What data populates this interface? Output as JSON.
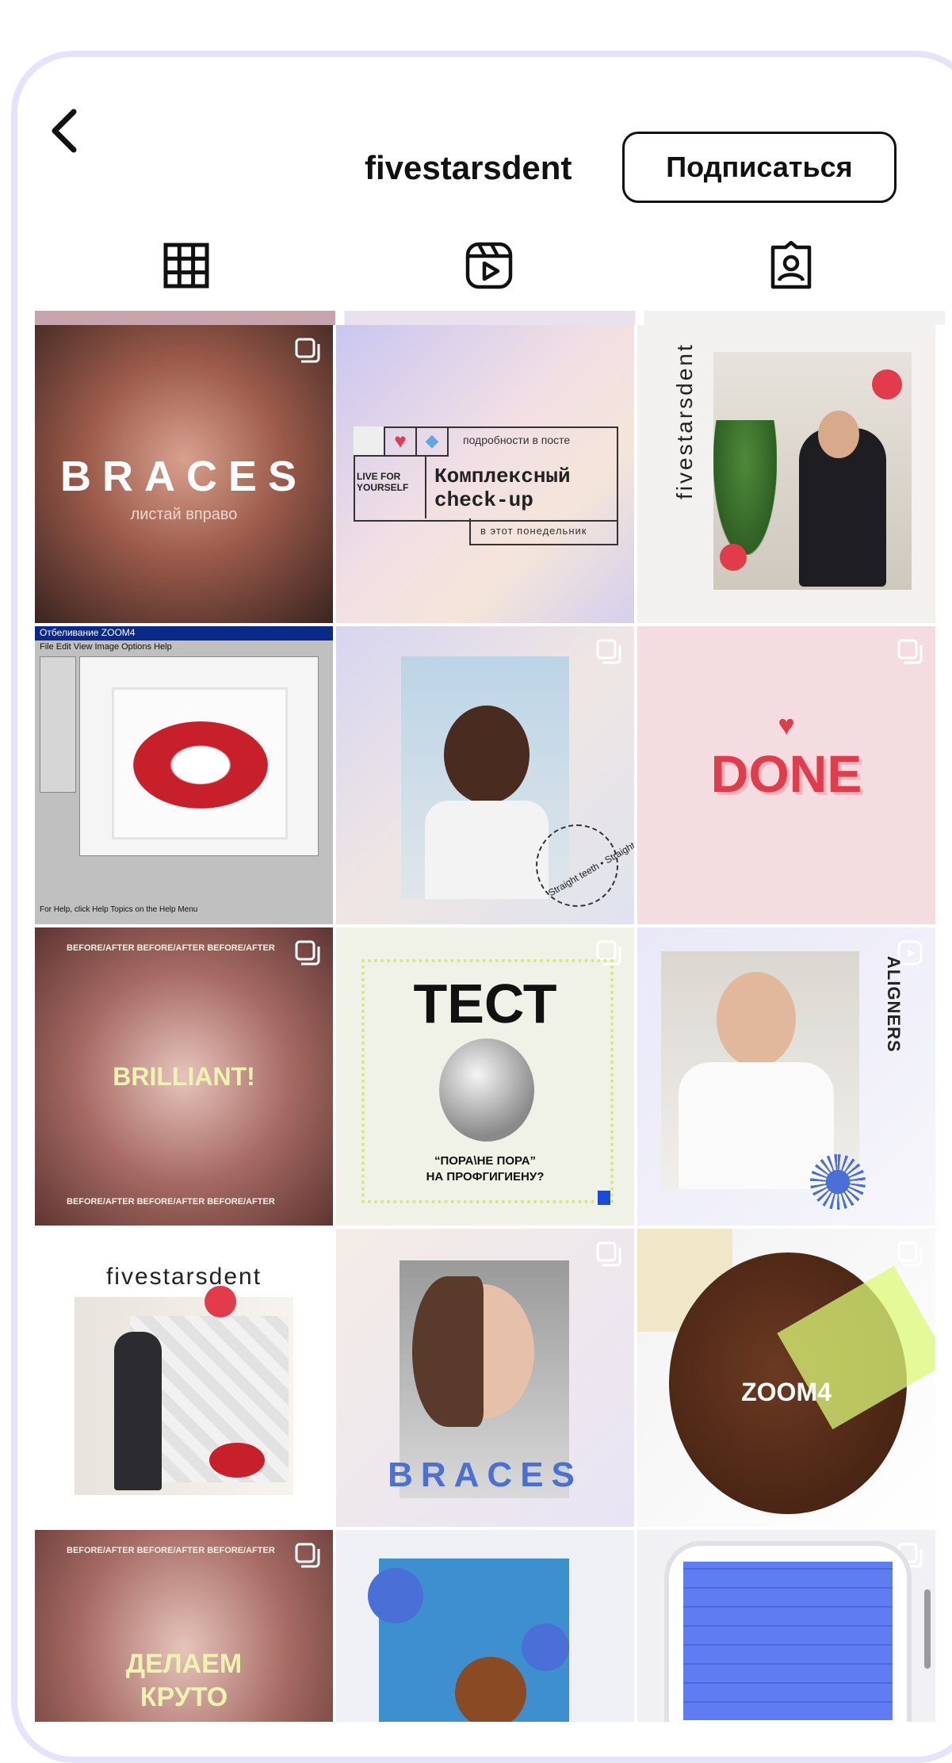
{
  "header": {
    "username": "fivestarsdent",
    "subscribe_label": "Подписаться"
  },
  "tabs": [
    {
      "icon": "grid-icon",
      "active": true
    },
    {
      "icon": "reels-icon",
      "active": false
    },
    {
      "icon": "tagged-icon",
      "active": false
    }
  ],
  "posts": {
    "p1": {
      "title": "BRACES",
      "subtitle": "листай вправо"
    },
    "p2": {
      "note": "подробности в посте",
      "tagline": "LIVE FOR YOURSELF",
      "headline1": "Комплексный",
      "headline2": "check-up",
      "footer": "в этот понедельник"
    },
    "p3": {
      "brand": "fivestarsdent"
    },
    "p4": {
      "window_title": "Отбеливание ZOOM4",
      "menu": "File  Edit  View  Image  Options  Help",
      "status": "For Help, click Help Topics on the Help Menu"
    },
    "p5": {
      "circle_text": "Straight teeth • Straight teeth •"
    },
    "p6": {
      "title": "DONE"
    },
    "p7": {
      "title": "BRILLIANT!",
      "frame_text": "BEFORE/AFTER BEFORE/AFTER BEFORE/AFTER"
    },
    "p8": {
      "title": "ТЕСТ",
      "caption1": "“ПОРА\\НЕ ПОРА”",
      "caption2": "НА ПРОФГИГИЕНУ?"
    },
    "p9": {
      "title": "ALIGNERS"
    },
    "p10": {
      "brand": "fivestarsdent"
    },
    "p11": {
      "title": "BRACES"
    },
    "p12": {
      "title": "ZOOM4"
    },
    "p13": {
      "title1": "ДЕЛАЕМ",
      "title2": "КРУТО",
      "frame_text": "BEFORE/AFTER BEFORE/AFTER BEFORE/AFTER"
    }
  },
  "colors": {
    "frame": "#e6e2fb",
    "accent_red": "#e23b4b",
    "accent_blue": "#4a6fd6"
  }
}
